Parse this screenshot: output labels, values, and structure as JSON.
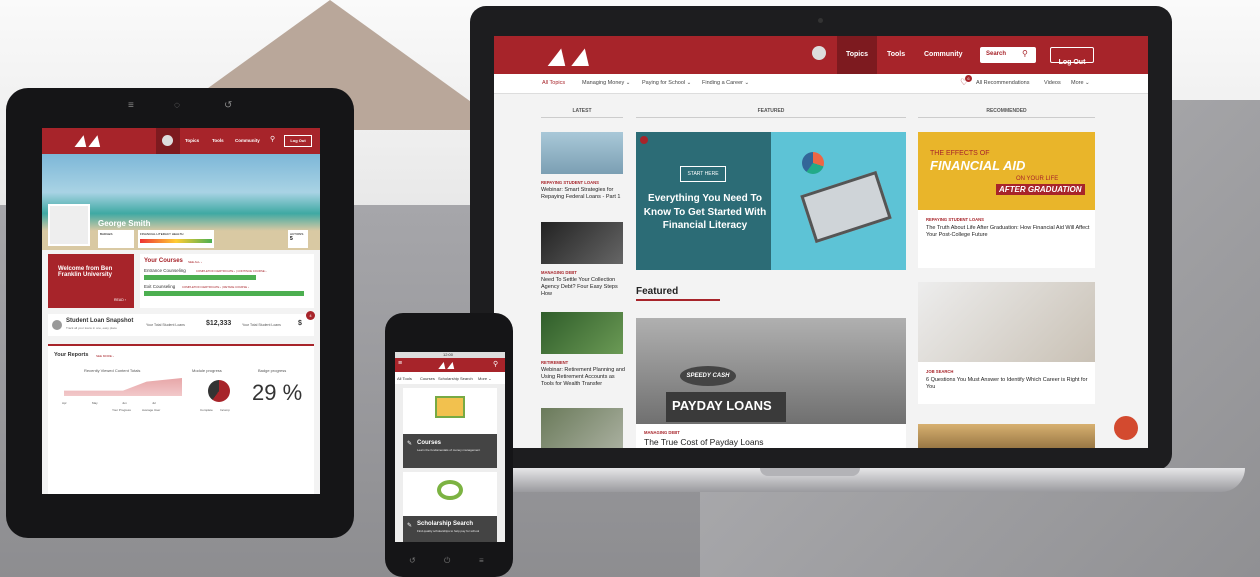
{
  "brand": {
    "red": "#a7242a",
    "green": "#4caf50"
  },
  "laptop": {
    "nav": {
      "topics": "Topics",
      "tools": "Tools",
      "community": "Community",
      "search": "Search",
      "logout": "Log Out"
    },
    "subnav": {
      "all_topics": "All Topics",
      "managing_money": "Managing Money ⌄",
      "paying_school": "Paying for School ⌄",
      "finding_career": "Finding a Career ⌄",
      "badge": "6",
      "all_recs": "All Recommendations",
      "videos": "Videos",
      "more": "More ⌄"
    },
    "columns": {
      "latest": "LATEST",
      "featured": "FEATURED",
      "recommended": "RECOMMENDED"
    },
    "latest": [
      {
        "cat": "REPAYING STUDENT LOANS",
        "title": "Webinar: Smart Strategies for Repaying Federal Loans - Part 1"
      },
      {
        "cat": "MANAGING DEBT",
        "title": "Need To Settle Your Collection Agency Debt? Four Easy Steps How"
      },
      {
        "cat": "RETIREMENT",
        "title": "Webinar: Retirement Planning and Using Retirement Accounts as Tools for Wealth Transfer"
      }
    ],
    "hero": {
      "start": "START HERE",
      "title": "Everything You Need To Know To Get Started With Financial Literacy"
    },
    "featured_heading": "Featured",
    "feature2": {
      "cat": "MANAGING DEBT",
      "title": "The True Cost of Payday Loans",
      "sign1": "SPEEDY CASH",
      "sign2": "PAYDAY LOANS",
      "sign3": "TITLE"
    },
    "rec": [
      {
        "img1": "THE EFFECTS OF",
        "img2": "FINANCIAL AID",
        "img3": "ON YOUR LIFE",
        "img4": "AFTER GRADUATION",
        "cat": "REPAYING STUDENT LOANS",
        "title": "The Truth About Life After Graduation: How Financial Aid Will Affect Your Post-College Future"
      },
      {
        "cat": "JOB SEARCH",
        "title": "6 Questions You Must Answer to Identify Which Career is Right for You"
      }
    ]
  },
  "tablet": {
    "nav": {
      "topics": "Topics",
      "tools": "Tools",
      "community": "Community",
      "logout": "Log Out"
    },
    "user": "George Smith",
    "badges": "BADGES",
    "fin": "FINANCIAL LITERACY HEALTH",
    "actions": "ACTIONS",
    "actions_val": "5",
    "welcome": "Welcome from Ben Franklin University",
    "read": "READ ›",
    "courses": {
      "title": "Your Courses",
      "see_all": "SEE ALL ›",
      "entrance": "Entrance Counseling",
      "entrance_links": "COMPLETION CERTIFICATE › | CONTINUE COURSE ›",
      "exit": "Exit Counseling",
      "exit_links": "COMPLETION CERTIFICATE › | RETAKE COURSE ›"
    },
    "snapshot": {
      "title": "Student Loan Snapshot",
      "sub": "Track all your loans in one, easy place",
      "label": "Your Total Student Loans",
      "value": "$12,333",
      "label2": "Your Total Student Loans",
      "cut": "$",
      "badge": "4"
    },
    "reports": {
      "title": "Your Reports",
      "see_more": "SEE MORE ›",
      "chart_title": "Recently Viewed Content Totals",
      "months": [
        "Apr",
        "May",
        "Jun",
        "Jul"
      ],
      "legend1": "Your Progress",
      "legend2": "Average User",
      "module": "Module progress",
      "module_legend1": "Complete",
      "module_legend2": "Incomp",
      "badge_progress": "Badge progress",
      "badge_value": "29 %"
    }
  },
  "phone": {
    "time": "12:00",
    "nav": [
      "All Tools",
      "Courses",
      "Scholarship Search",
      "More ⌄"
    ],
    "card1": {
      "title": "Courses",
      "sub": "Learn the fundamentals of money management"
    },
    "card2": {
      "title": "Scholarship Search",
      "sub": "Find quality scholarships to help pay for school"
    }
  }
}
